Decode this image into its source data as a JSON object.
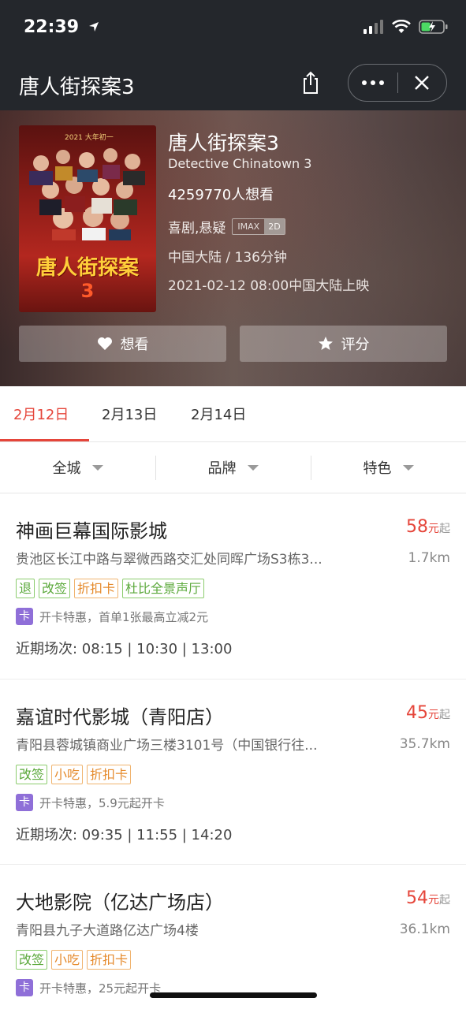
{
  "status": {
    "time": "22:39"
  },
  "nav": {
    "title": "唐人街探案3",
    "share_icon": "share-icon",
    "more_icon": "more-icon",
    "close_icon": "close-icon"
  },
  "movie": {
    "title": "唐人街探案3",
    "english_title": "Detective Chinatown 3",
    "want_count": "4259770人想看",
    "genre": "喜剧,悬疑",
    "format_a": "IMAX",
    "format_b": "2D",
    "region_duration": "中国大陆 / 136分钟",
    "release": "2021-02-12 08:00中国大陆上映",
    "poster": {
      "top_tag": "2021 大年初一",
      "title": "唐人街探案",
      "number": "3"
    },
    "want_button": "想看",
    "rate_button": "评分"
  },
  "date_tabs": [
    {
      "label": "2月12日",
      "active": true
    },
    {
      "label": "2月13日",
      "active": false
    },
    {
      "label": "2月14日",
      "active": false
    }
  ],
  "filters": [
    {
      "label": "全城"
    },
    {
      "label": "品牌"
    },
    {
      "label": "特色"
    }
  ],
  "cinemas": [
    {
      "name": "神画巨幕国际影城",
      "price": "58",
      "price_unit": "元",
      "price_suffix": "起",
      "address": "贵池区长江中路与翠微西路交汇处同晖广场S3栋3...",
      "distance": "1.7km",
      "tags": [
        {
          "text": "退",
          "color": "green"
        },
        {
          "text": "改签",
          "color": "green"
        },
        {
          "text": "折扣卡",
          "color": "orange"
        },
        {
          "text": "杜比全景声厅",
          "color": "green"
        }
      ],
      "card_badge": "卡",
      "card_text": "开卡特惠，首单1张最高立减2元",
      "showtimes": "近期场次: 08:15 | 10:30 | 13:00"
    },
    {
      "name": "嘉谊时代影城（青阳店）",
      "price": "45",
      "price_unit": "元",
      "price_suffix": "起",
      "address": "青阳县蓉城镇商业广场三楼3101号（中国银行往...",
      "distance": "35.7km",
      "tags": [
        {
          "text": "改签",
          "color": "green"
        },
        {
          "text": "小吃",
          "color": "orange"
        },
        {
          "text": "折扣卡",
          "color": "orange"
        }
      ],
      "card_badge": "卡",
      "card_text": "开卡特惠，5.9元起开卡",
      "showtimes": "近期场次: 09:35 | 11:55 | 14:20"
    },
    {
      "name": "大地影院（亿达广场店）",
      "price": "54",
      "price_unit": "元",
      "price_suffix": "起",
      "address": "青阳县九子大道路亿达广场4楼",
      "distance": "36.1km",
      "tags": [
        {
          "text": "改签",
          "color": "green"
        },
        {
          "text": "小吃",
          "color": "orange"
        },
        {
          "text": "折扣卡",
          "color": "orange"
        }
      ],
      "card_badge": "卡",
      "card_text": "开卡特惠，25元起开卡",
      "showtimes": ""
    }
  ]
}
